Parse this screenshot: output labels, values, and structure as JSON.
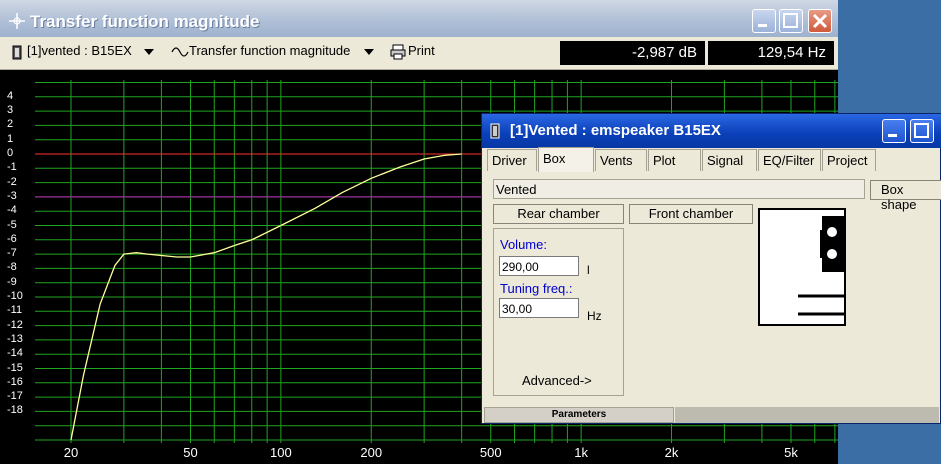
{
  "main_window": {
    "title": "Transfer function magnitude",
    "toolbar": {
      "source_selector": "[1]vented : B15EX",
      "plot_selector": "Transfer function magnitude",
      "print_label": "Print"
    },
    "readouts": {
      "level": "-2,987 dB",
      "frequency": "129,54 Hz"
    }
  },
  "chart_data": {
    "type": "line",
    "y_ticks": [
      "4",
      "3",
      "2",
      "1",
      "0",
      "-1",
      "-2",
      "-3",
      "-4",
      "-5",
      "-6",
      "-7",
      "-8",
      "-9",
      "-10",
      "-11",
      "-12",
      "-13",
      "-14",
      "-15",
      "-16",
      "-17",
      "-18"
    ],
    "x_ticks": [
      "20",
      "50",
      "100",
      "200",
      "500",
      "1k",
      "2k",
      "5k"
    ],
    "ylim": [
      -20,
      5
    ],
    "xlim": [
      15,
      7000
    ],
    "x_scale": "log",
    "grid": true,
    "reference_lines": [
      {
        "value": 0,
        "color": "#ff3030"
      },
      {
        "value": -3,
        "color": "#c020c0"
      }
    ],
    "series": [
      {
        "color": "#ffff99",
        "x": [
          20,
          22,
          25,
          28,
          30,
          33,
          36,
          40,
          45,
          50,
          60,
          70,
          80,
          100,
          130,
          160,
          200,
          250,
          300,
          350,
          400
        ],
        "y": [
          -20,
          -15.5,
          -10.5,
          -7.8,
          -7.0,
          -6.9,
          -7.0,
          -7.1,
          -7.2,
          -7.2,
          -6.9,
          -6.4,
          -6.0,
          -5.0,
          -3.8,
          -2.7,
          -1.7,
          -0.9,
          -0.35,
          -0.1,
          0
        ]
      }
    ]
  },
  "param_window": {
    "title": "[1]Vented : emspeaker B15EX",
    "tabs": [
      "Driver",
      "Box",
      "Vents",
      "Plot",
      "Signal",
      "EQ/Filter",
      "Project"
    ],
    "box_type": "Vented",
    "box_shape_button": "Box shape",
    "rear_chamber_button": "Rear chamber",
    "front_chamber_button": "Front chamber",
    "volume_label": "Volume:",
    "volume_value": "290,00",
    "volume_unit": "l",
    "tuning_label": "Tuning freq.:",
    "tuning_value": "30,00",
    "tuning_unit": "Hz",
    "advanced_link": "Advanced->",
    "status": "Parameters"
  }
}
